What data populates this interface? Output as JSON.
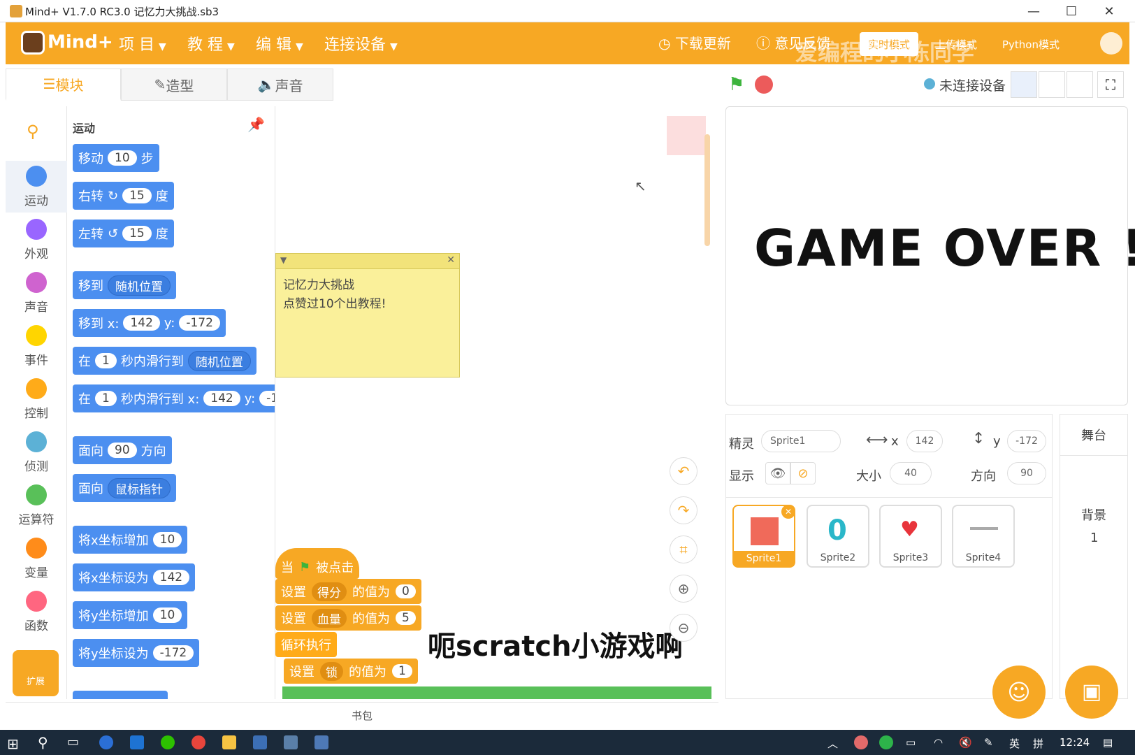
{
  "window": {
    "title": "Mind+ V1.7.0 RC3.0   记忆力大挑战.sb3",
    "minimize": "—",
    "maximize": "☐",
    "close": "✕"
  },
  "menubar": {
    "logo": "Mind+",
    "items": [
      "项 目",
      "教 程",
      "编 辑",
      "连接设备"
    ],
    "download_update": "下载更新",
    "feedback": "意见反馈",
    "mode_realtime": "实时模式",
    "mode_upload": "上传模式",
    "mode_python": "Python模式",
    "watermark": "爱编程的小陈同学"
  },
  "tabs": {
    "blocks": "模块",
    "costumes": "造型",
    "sounds": "声音"
  },
  "toolbar": {
    "device_status": "未连接设备"
  },
  "categories": [
    {
      "label": "运动",
      "color": "#4c8ff0"
    },
    {
      "label": "外观",
      "color": "#9966ff"
    },
    {
      "label": "声音",
      "color": "#cf63cf"
    },
    {
      "label": "事件",
      "color": "#ffd500"
    },
    {
      "label": "控制",
      "color": "#ffab19"
    },
    {
      "label": "侦测",
      "color": "#5cb1d6"
    },
    {
      "label": "运算符",
      "color": "#59c059"
    },
    {
      "label": "变量",
      "color": "#ff8c1a"
    },
    {
      "label": "函数",
      "color": "#ff6680"
    }
  ],
  "extension_label": "扩展",
  "palette": {
    "heading": "运动",
    "blocks": {
      "move": {
        "a": "移动",
        "n": "10",
        "b": "步"
      },
      "turn_right": {
        "a": "右转",
        "n": "15",
        "b": "度"
      },
      "turn_left": {
        "a": "左转",
        "n": "15",
        "b": "度"
      },
      "goto": {
        "a": "移到",
        "dd": "随机位置"
      },
      "goto_xy": {
        "a": "移到 x:",
        "x": "142",
        "ylab": "y:",
        "y": "-172"
      },
      "glide": {
        "a": "在",
        "n": "1",
        "b": "秒内滑行到",
        "dd": "随机位置"
      },
      "glide_xy": {
        "a": "在",
        "n": "1",
        "b": "秒内滑行到 x:",
        "x": "142",
        "ylab": "y:",
        "y": "-1"
      },
      "point_dir": {
        "a": "面向",
        "n": "90",
        "b": "方向"
      },
      "point_to": {
        "a": "面向",
        "dd": "鼠标指针"
      },
      "change_x": {
        "a": "将x坐标增加",
        "n": "10"
      },
      "set_x": {
        "a": "将x坐标设为",
        "n": "142"
      },
      "change_y": {
        "a": "将y坐标增加",
        "n": "10"
      },
      "set_y": {
        "a": "将y坐标设为",
        "n": "-172"
      }
    }
  },
  "note": {
    "line1": "记忆力大挑战",
    "line2": "点赞过10个出教程!"
  },
  "script": {
    "hat": {
      "a": "当",
      "b": "被点击"
    },
    "set_score": {
      "a": "设置",
      "dd": "得分",
      "b": "的值为",
      "n": "0"
    },
    "set_hp": {
      "a": "设置",
      "dd": "血量",
      "b": "的值为",
      "n": "5"
    },
    "forever": "循环执行",
    "set_lock": {
      "a": "设置",
      "dd": "锁",
      "b": "的值为",
      "n": "1"
    }
  },
  "subtitle": "呃scratch小游戏啊",
  "backpack": "书包",
  "stage": {
    "text": "GAME OVER !"
  },
  "sprite_info": {
    "sprite_label": "精灵",
    "sprite_name": "Sprite1",
    "x_label": "x",
    "x": "142",
    "y_label": "y",
    "y": "-172",
    "show_label": "显示",
    "size_label": "大小",
    "size": "40",
    "direction_label": "方向",
    "direction": "90"
  },
  "sprites": [
    {
      "name": "Sprite1"
    },
    {
      "name": "Sprite2"
    },
    {
      "name": "Sprite3"
    },
    {
      "name": "Sprite4"
    }
  ],
  "stage_panel": {
    "title": "舞台",
    "backdrop_label": "背景",
    "backdrop_count": "1"
  },
  "taskbar": {
    "ime": "英",
    "ime2": "拼",
    "time": "12:24"
  }
}
